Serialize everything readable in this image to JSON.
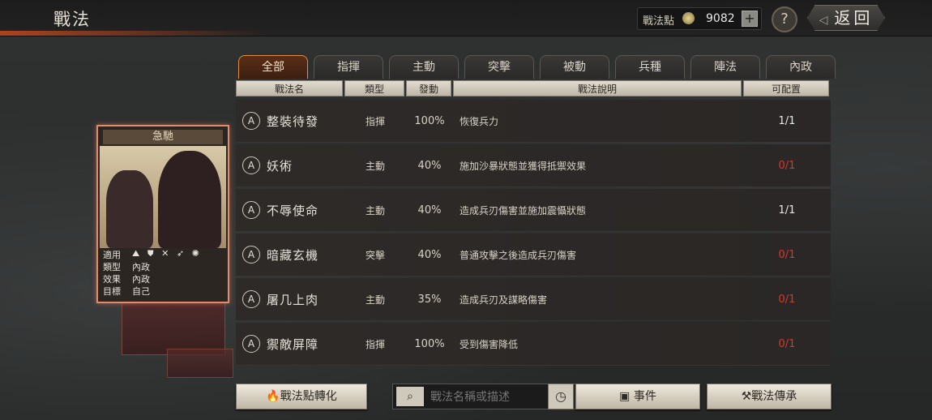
{
  "header": {
    "title": "戰法",
    "points_label": "戰法點",
    "points_value": "9082",
    "help_label": "?",
    "back_label": "返回"
  },
  "card": {
    "title": "急馳",
    "rows": [
      {
        "key": "適用",
        "value": "⛰ ⛊ ✕ ➶ ✺"
      },
      {
        "key": "類型",
        "value": "內政"
      },
      {
        "key": "效果",
        "value": "內政"
      },
      {
        "key": "目標",
        "value": "自己"
      }
    ]
  },
  "tabs": [
    "全部",
    "指揮",
    "主動",
    "突擊",
    "被動",
    "兵種",
    "陣法",
    "內政"
  ],
  "columns": [
    "戰法名",
    "類型",
    "發動",
    "戰法說明",
    "可配置"
  ],
  "rows": [
    {
      "grade": "A",
      "name": "整裝待發",
      "type": "指揮",
      "rate": "100%",
      "desc": "恢復兵力",
      "config": "1/1",
      "config_color": "white"
    },
    {
      "grade": "A",
      "name": "妖術",
      "type": "主動",
      "rate": "40%",
      "desc": "施加沙暴狀態並獲得抵禦效果",
      "config": "0/1",
      "config_color": "red"
    },
    {
      "grade": "A",
      "name": "不辱使命",
      "type": "主動",
      "rate": "40%",
      "desc": "造成兵刃傷害並施加震懾狀態",
      "config": "1/1",
      "config_color": "white"
    },
    {
      "grade": "A",
      "name": "暗藏玄機",
      "type": "突擊",
      "rate": "40%",
      "desc": "普通攻擊之後造成兵刃傷害",
      "config": "0/1",
      "config_color": "red"
    },
    {
      "grade": "A",
      "name": "屠几上肉",
      "type": "主動",
      "rate": "35%",
      "desc": "造成兵刃及謀略傷害",
      "config": "0/1",
      "config_color": "red"
    },
    {
      "grade": "A",
      "name": "禦敵屏障",
      "type": "指揮",
      "rate": "100%",
      "desc": "受到傷害降低",
      "config": "0/1",
      "config_color": "red"
    }
  ],
  "bottom": {
    "convert_label": "戰法點轉化",
    "search_placeholder": "戰法名稱或描述",
    "event_label": "事件",
    "inherit_label": "戰法傳承"
  },
  "colors": {
    "accent": "#e08c3e",
    "red": "#d23a2a"
  }
}
